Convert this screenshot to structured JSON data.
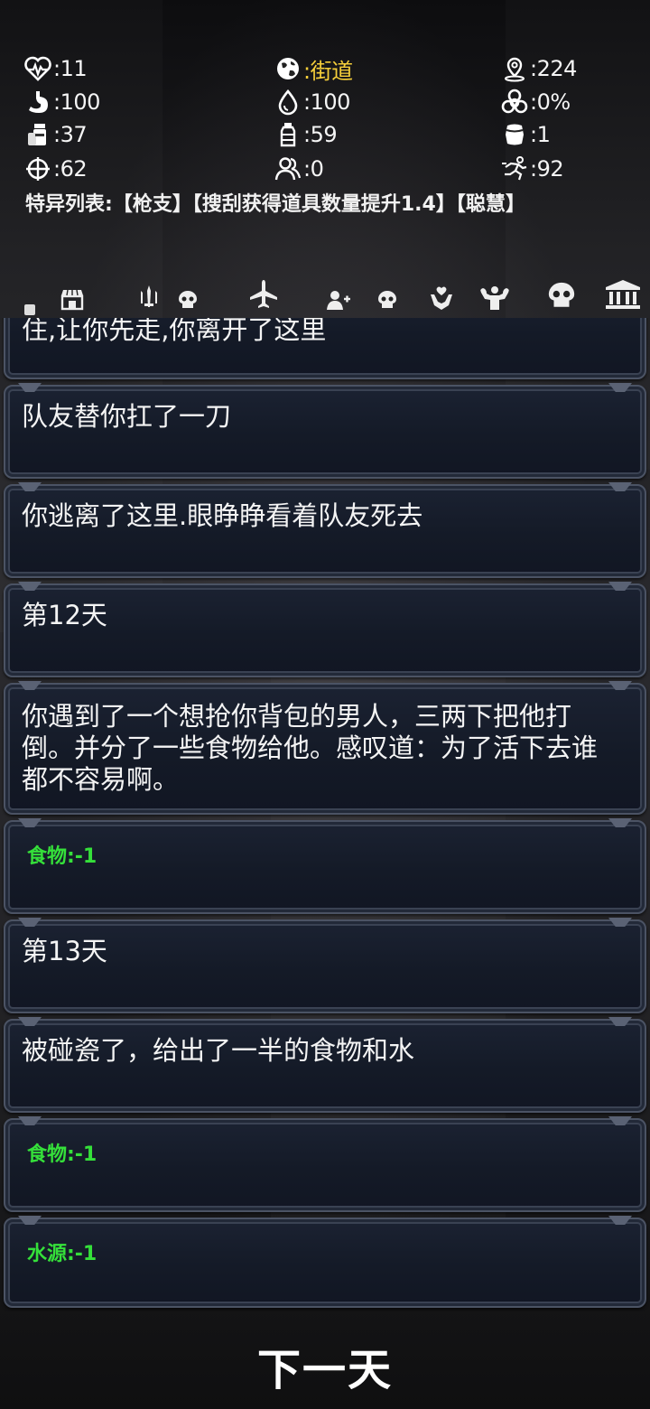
{
  "stats": {
    "health": {
      "icon": "heart-pulse-icon",
      "text": ":11"
    },
    "location": {
      "icon": "globe-icon",
      "text": ":街道"
    },
    "distance": {
      "icon": "map-pin-icon",
      "text": ":224"
    },
    "hunger": {
      "icon": "stomach-icon",
      "text": ":100"
    },
    "thirst": {
      "icon": "water-drop-icon",
      "text": ":100"
    },
    "infection": {
      "icon": "biohazard-icon",
      "text": ":0%"
    },
    "food": {
      "icon": "food-can-icon",
      "text": ":37"
    },
    "water": {
      "icon": "water-bottle-icon",
      "text": ":59"
    },
    "supplies": {
      "icon": "barrel-icon",
      "text": ":1"
    },
    "accuracy": {
      "icon": "crosshair-icon",
      "text": ":62"
    },
    "teammates": {
      "icon": "people-icon",
      "text": ":0"
    },
    "agility": {
      "icon": "running-icon",
      "text": ":92"
    }
  },
  "traits": {
    "label": "特异列表:",
    "items": [
      "【枪支】",
      "【搜刮获得道具数量提升1.4】",
      "【聪慧】"
    ]
  },
  "tabs": [
    {
      "name": "shop-icon"
    },
    {
      "name": "weapon-icon"
    },
    {
      "name": "skull-icon"
    },
    {
      "name": "airplane-icon"
    },
    {
      "name": "add-person-icon"
    },
    {
      "name": "skull-icon"
    },
    {
      "name": "heal-hands-icon"
    },
    {
      "name": "muscle-icon"
    },
    {
      "name": "skull-large-icon"
    },
    {
      "name": "bank-icon"
    }
  ],
  "log": [
    {
      "type": "text",
      "text": "因及由个定战效,去试逃跑,逃跑失败,队友死死的拖住,让你先走,你离开了这里"
    },
    {
      "type": "text",
      "text": "队友替你扛了一刀"
    },
    {
      "type": "text",
      "text": "你逃离了这里.眼睁睁看着队友死去"
    },
    {
      "type": "text",
      "text": "第12天"
    },
    {
      "type": "text",
      "text": "你遇到了一个想抢你背包的男人，三两下把他打倒。并分了一些食物给他。感叹道：为了活下去谁都不容易啊。"
    },
    {
      "type": "effect",
      "text": "食物:-1"
    },
    {
      "type": "text",
      "text": "第13天"
    },
    {
      "type": "text",
      "text": "被碰瓷了，给出了一半的食物和水"
    },
    {
      "type": "effect",
      "text": "食物:-1"
    },
    {
      "type": "effect",
      "text": "水源:-1"
    }
  ],
  "next_day_label": "下一天",
  "colors": {
    "location": "#f6cf3a",
    "effect": "#35e03a",
    "card": "#161c29"
  }
}
